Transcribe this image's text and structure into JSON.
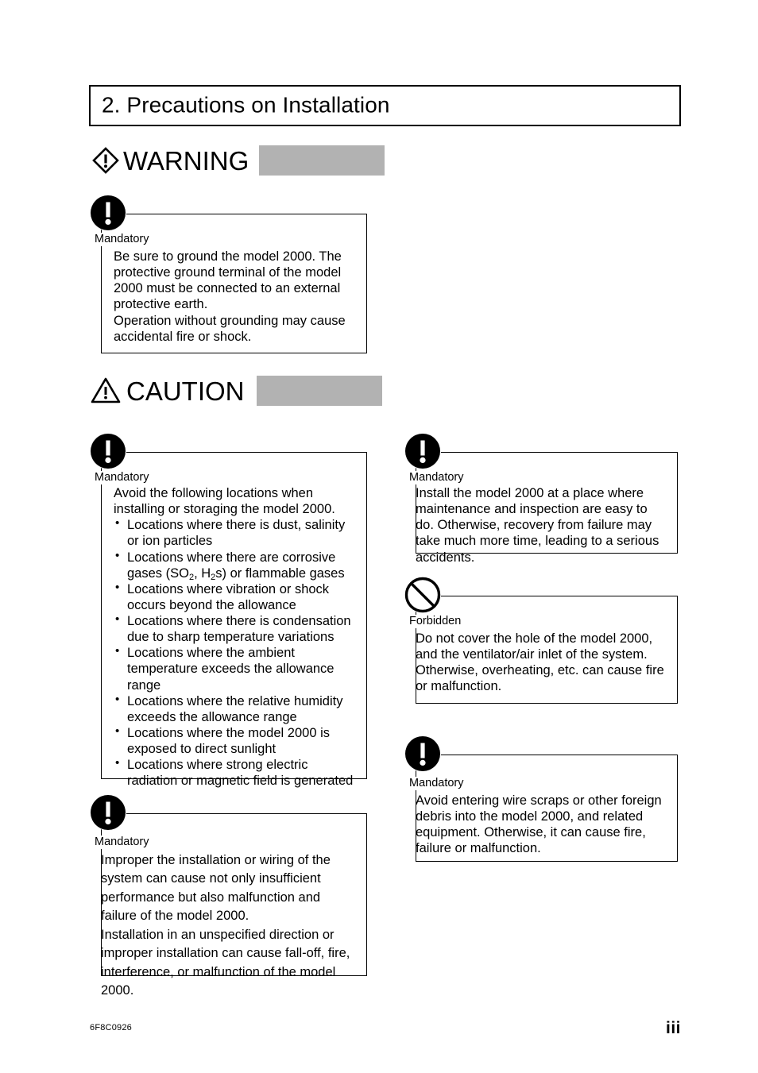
{
  "document": {
    "chapter_title": "2. Precautions on Installation",
    "footer_code": "6F8C0926",
    "page_number": "iii"
  },
  "banners": {
    "warning": {
      "label": "WARNING",
      "icon": "warning-diamond-icon",
      "bar_color": "#b2b2b2"
    },
    "caution": {
      "label": "CAUTION",
      "icon": "caution-triangle-icon",
      "bar_color": "#b2b2b2"
    }
  },
  "labels": {
    "mandatory": "Mandatory",
    "forbidden": "Forbidden"
  },
  "advisories": {
    "ground": {
      "kind": "Mandatory",
      "icon": "mandatory-exclamation-icon",
      "lines": [
        "Be sure to ground the model 2000. The protective ground terminal of the model 2000 must be connected to an external protective earth.",
        "Operation without grounding may cause accidental fire or shock."
      ]
    },
    "locations": {
      "kind": "Mandatory",
      "icon": "mandatory-exclamation-icon",
      "intro": "Avoid the following locations when installing or storaging the model 2000.",
      "items": [
        "Locations where there is dust, salinity or ion particles",
        "Locations where there are corrosive gases (SO2, H2s) or flammable gases",
        "Locations where vibration or shock occurs beyond the allowance",
        "Locations where there is condensation due to sharp temperature variations",
        "Locations where the ambient temperature exceeds the allowance range",
        "Locations where the relative humidity exceeds the allowance range",
        "Locations where the model 2000 is exposed to direct sunlight",
        "Locations where strong electric radiation or magnetic field is generated"
      ]
    },
    "improper": {
      "kind": "Mandatory",
      "icon": "mandatory-exclamation-icon",
      "lines": [
        "Improper the installation or wiring of the system can cause not only insufficient performance but also malfunction and failure of the model 2000.",
        "Installation in an unspecified direction or improper installation can cause fall-off, fire, interference, or malfunction of the model 2000."
      ]
    },
    "maintain": {
      "kind": "Mandatory",
      "icon": "mandatory-exclamation-icon",
      "lines": [
        "Install the model 2000 at a place where maintenance and inspection are easy to do. Otherwise, recovery from failure may take much more time, leading to a serious accidents."
      ]
    },
    "forbidden": {
      "kind": "Forbidden",
      "icon": "forbidden-circle-slash-icon",
      "lines": [
        "Do not cover the hole of the model 2000, and the ventilator/air inlet of the system.",
        "Otherwise, overheating, etc. can cause fire or malfunction."
      ]
    },
    "debris": {
      "kind": "Mandatory",
      "icon": "mandatory-exclamation-icon",
      "lines": [
        "Avoid entering wire scraps or other foreign debris into the model 2000, and related equipment. Otherwise, it can cause fire, failure or malfunction."
      ]
    }
  }
}
